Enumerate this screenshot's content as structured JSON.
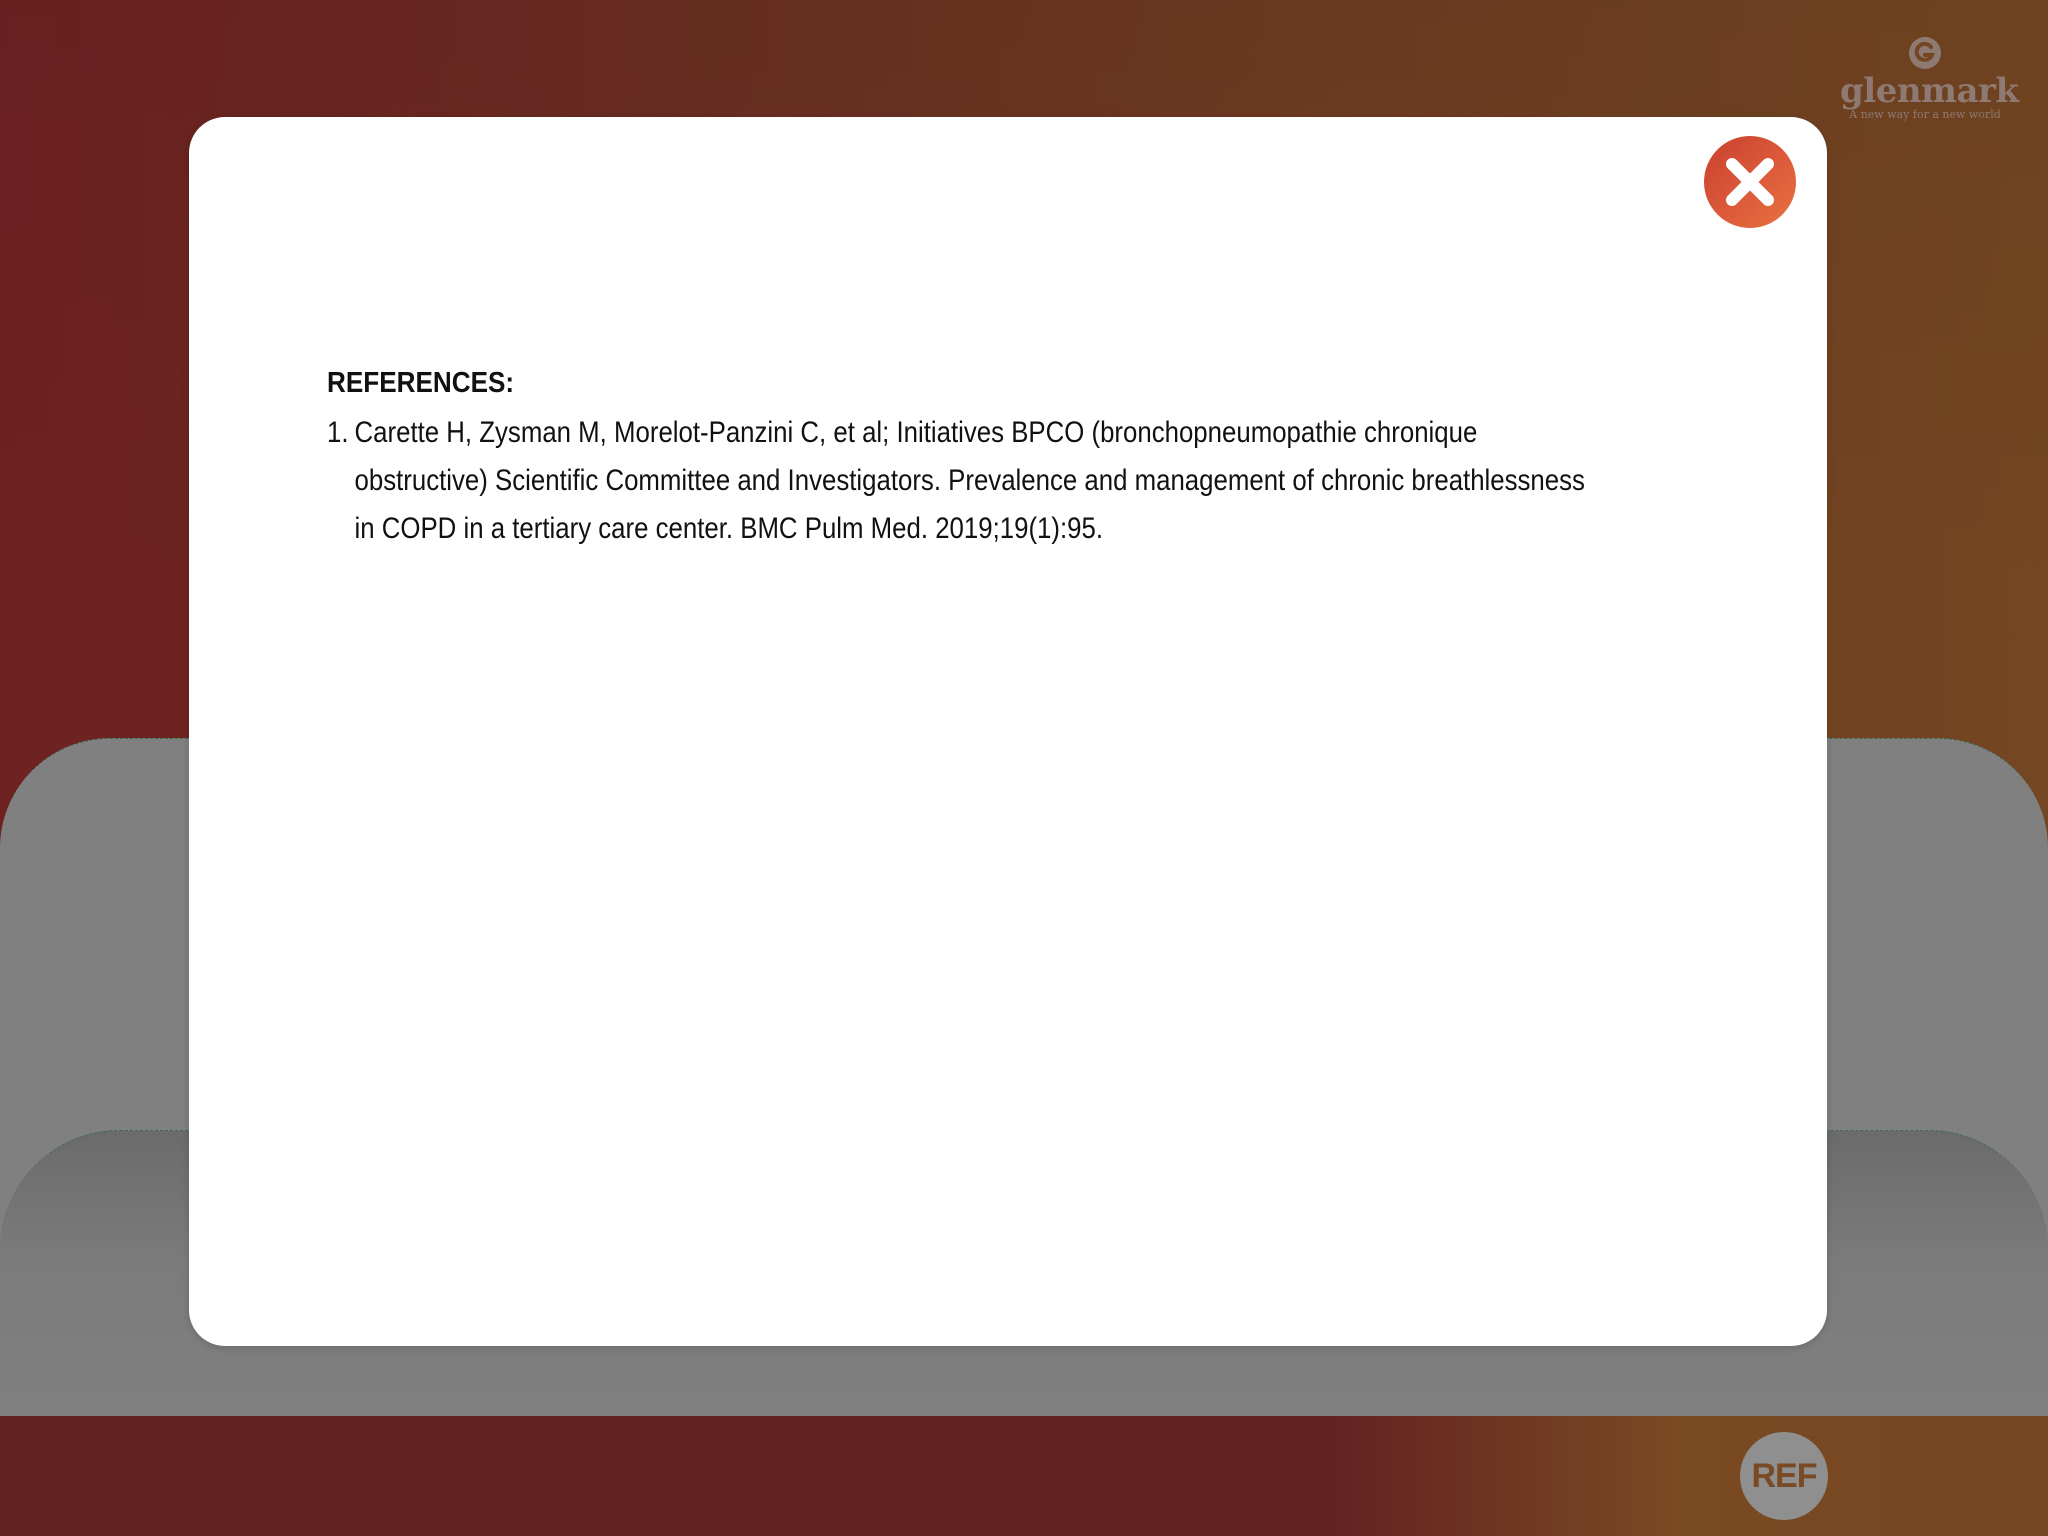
{
  "brand": {
    "name": "glenmark",
    "tagline": "A new way for a new world",
    "logo_color": "#8e7a72"
  },
  "footer": {
    "ref_button_label": "REF"
  },
  "modal": {
    "close_icon": "close-x-icon",
    "close_color": "#d9553a",
    "heading": "REFERENCES:",
    "references": [
      {
        "number": "1.",
        "lines": [
          "Carette H, Zysman M, Morelot-Panzini C, et al; Initiatives BPCO (bronchopneumopathie chronique",
          "obstructive) Scientific Committee and Investigators. Prevalence and management of chronic breathlessness",
          "in COPD in a tertiary care center. BMC Pulm Med. 2019;19(1):95."
        ]
      }
    ]
  },
  "colors": {
    "background_left": "#6e2121",
    "background_right": "#744621",
    "card_gray": "#808080",
    "modal_bg": "#ffffff"
  }
}
